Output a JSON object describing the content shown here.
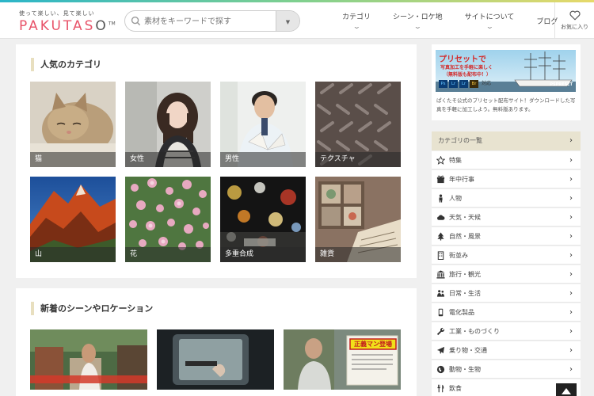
{
  "header": {
    "tagline": "使って楽しい、見て楽しい",
    "logo_text": "PAKUTAS",
    "logo_tm": "TM",
    "search_placeholder": "素材をキーワードで探す",
    "nav": [
      "カテゴリ",
      "シーン・ロケ地",
      "サイトについて",
      "ブログ"
    ],
    "favorites": "お気に入り"
  },
  "popular": {
    "title": "人気のカテゴリ",
    "tiles": [
      "猫",
      "女性",
      "男性",
      "テクスチャ",
      "山",
      "花",
      "多重合成",
      "雑貨"
    ]
  },
  "scenes": {
    "title": "新着のシーンやロケーション",
    "thumb3_sign": "正義マン登場"
  },
  "sidebar": {
    "banner_title": "プリセットで",
    "banner_sub": "写真加工を手軽に楽しく",
    "banner_free": "（無料版も配布中！）",
    "banner_apps": [
      "Ps",
      "Lr",
      "Lr",
      "Br"
    ],
    "banner_compat": "対応",
    "banner_brand": "PSPRESET",
    "banner_desc": "ぱくたそ公式のプリセット配布サイト！ダウンロードした写真を手軽に加工しよう。無料版あります。",
    "category_header": "カテゴリの一覧",
    "categories": [
      {
        "label": "特集",
        "icon": "star-icon"
      },
      {
        "label": "年中行事",
        "icon": "gift-icon"
      },
      {
        "label": "人物",
        "icon": "person-icon"
      },
      {
        "label": "天気・天候",
        "icon": "cloud-icon"
      },
      {
        "label": "自然・風景",
        "icon": "tree-icon"
      },
      {
        "label": "街並み",
        "icon": "building-icon"
      },
      {
        "label": "旅行・観光",
        "icon": "temple-icon"
      },
      {
        "label": "日常・生活",
        "icon": "people-icon"
      },
      {
        "label": "電化製品",
        "icon": "device-icon"
      },
      {
        "label": "工業・ものづくり",
        "icon": "wrench-icon"
      },
      {
        "label": "乗り物・交通",
        "icon": "plane-icon"
      },
      {
        "label": "動物・生物",
        "icon": "globe-icon"
      },
      {
        "label": "飲食",
        "icon": "cutlery-icon"
      }
    ]
  },
  "colors": {
    "accent_pink": "#e8546a",
    "category_header_bg": "#e8e3d0",
    "banner_red": "#d32a2a"
  }
}
